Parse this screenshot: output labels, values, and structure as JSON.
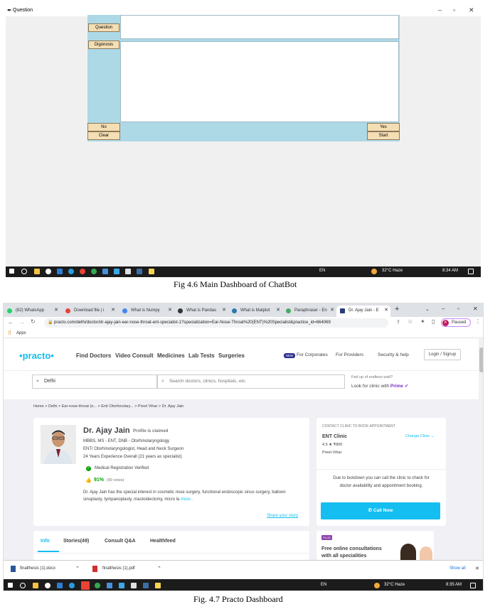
{
  "fig1": {
    "window_title": "Question",
    "buttons": {
      "question": "Question",
      "diagnosis": "Digonosis",
      "no": "No",
      "clear": "Clear",
      "yes": "Yes",
      "start": "Start"
    },
    "taskbar": {
      "lang": "EN",
      "weather": "32°C  Haze",
      "time": "8:34 AM"
    },
    "caption": "Fig 4.6  Main Dashboard of ChatBot"
  },
  "fig2": {
    "tabs": [
      "(82) WhatsApp",
      "Download file | i",
      "What is Numpy",
      "What is Pandas",
      "What is Matplot",
      "Paraphraser - En",
      "Dr. Ajay Jain - E"
    ],
    "url": "practo.com/delhi/doctor/dr-ajay-jain-ear-nose-throat-ent-specialist-1?specialization=Ear-Nose-Throat%20(ENT)%20Specialist&practice_id=664069",
    "profile_status": "Paused",
    "apps_label": "Apps",
    "nav": {
      "logo": "practo",
      "find_doctors": "Find Doctors",
      "video_consult": "Video Consult",
      "medicines": "Medicines",
      "lab_tests": "Lab Tests",
      "surgeries": "Surgeries",
      "new_badge": "NEW",
      "for_corporates": "For Corporates",
      "for_providers": "For Providers",
      "security_help": "Security & help",
      "login": "Login / Signup"
    },
    "search": {
      "location": "Delhi",
      "placeholder": "Search doctors, clinics, hospitals, etc.",
      "promo_line1": "Fed up of endless wait?",
      "promo_line2": "Look for clinic with",
      "promo_prime": "Prime"
    },
    "breadcrumb": "Home  >  Delhi  >  Ear-nose-throat (e...  >  Ent/ Otorhinolary...  >  Preet Vihar  >  Dr. Ajay Jain",
    "doctor": {
      "name": "Dr. Ajay Jain",
      "claimed": "Profile is claimed",
      "degrees": "MBBS, MS - ENT, DNB - Otorhinolaryngology",
      "specialty": "ENT/ Otorhinolaryngologist, Head and Neck Surgeon",
      "experience": "24 Years Experience Overall  (21 years as specialist)",
      "verified": "Medical Registration Verified",
      "rating": "91%",
      "votes": "(90 votes)",
      "bio": "Dr. Ajay Jain has the special interest in cosmetic nose surgery, functional endoscopic sinus surgery, balloon sinuplasty, tympanoplasty, mastoidectomy, micro la",
      "more": "more..",
      "share": "Share your story"
    },
    "clinic": {
      "header": "CONTACT CLINIC TO BOOK APPOINTMENT",
      "name": "ENT Clinic",
      "change": "Change Clinic",
      "rating_fee": "4.5 ★  ₹800",
      "locality": "Preet Vihar",
      "lockdown": "Due to lockdown you can call the clinic to check for doctor availability and appointment booking.",
      "call": "Call Now"
    },
    "tabs_info": [
      "Info",
      "Stories(49)",
      "Consult Q&A",
      "Healthfeed"
    ],
    "promo": {
      "badge": "PLUS",
      "line1": "Free online consultations",
      "line2": "with all specialities"
    },
    "downloads": {
      "file1": "finalthesis (1).docx",
      "file2": "finalthesis (1).pdf",
      "show_all": "Show all"
    },
    "taskbar": {
      "lang": "EN",
      "weather": "32°C  Haze",
      "time": "8:35 AM"
    },
    "caption": "Fig. 4.7 Practo Dashboard"
  },
  "colors": {
    "chat_panel": "#add8e6",
    "chat_button": "#f5deb3",
    "practo_blue": "#14bef0",
    "call_button": "#14bef0",
    "rating_green": "#01a400"
  }
}
